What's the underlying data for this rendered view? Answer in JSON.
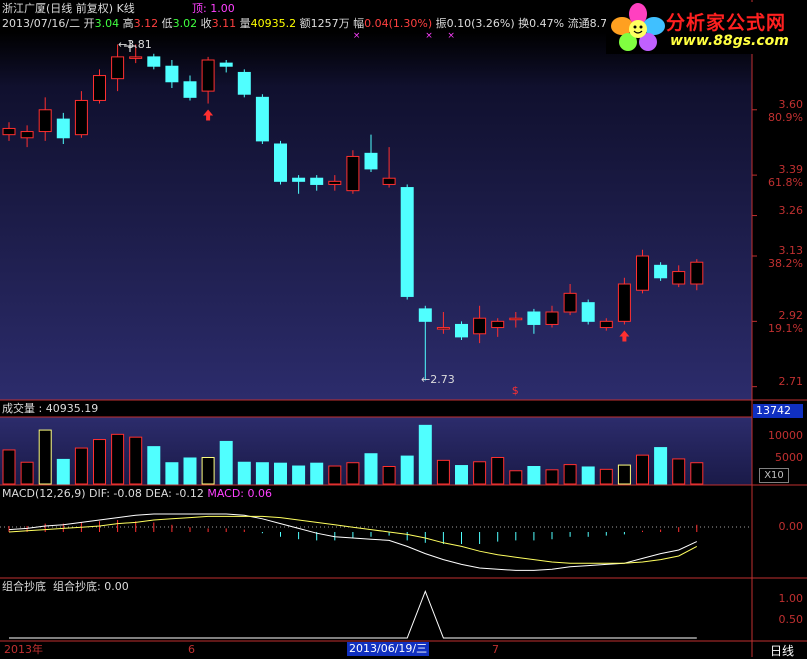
{
  "header": {
    "stock": "浙江广厦(日线 前复权) K线",
    "top_label": "顶: 1.00",
    "date": "2013/07/16/二",
    "open_label": "开",
    "open": "3.04",
    "high_label": "高",
    "high": "3.12",
    "low_label": "低",
    "low": "3.02",
    "close_label": "收",
    "close": "3.11",
    "vol_label": "量",
    "vol": "40935.2",
    "amount_label": "额",
    "amount": "1257万",
    "range_label": "幅",
    "range": "0.04(1.30%)",
    "amp_label": "振",
    "amp": "0.10(3.26%)",
    "turn_label": "换",
    "turn": "0.47%",
    "float_label": "流通",
    "float": "8.7"
  },
  "logo": {
    "title": "分析家公式网",
    "url": "www.88gs.com"
  },
  "colors": {
    "bg": "#000000",
    "panel": "#24245c",
    "up": "#ff3030",
    "down": "#50ffff",
    "grid": "#c03030"
  },
  "price_axis": [
    {
      "value": "3.60",
      "pct": "80.9%"
    },
    {
      "value": "3.39",
      "pct": "61.8%"
    },
    {
      "value": "3.26",
      "pct": ""
    },
    {
      "value": "3.13",
      "pct": "38.2%"
    },
    {
      "value": "2.92",
      "pct": "19.1%"
    },
    {
      "value": "2.71",
      "pct": ""
    }
  ],
  "price_annotations": {
    "high_mark": "3.81",
    "low_mark": "2.73"
  },
  "volume": {
    "title": "成交量",
    "value": ": 40935.19",
    "badge": "13742",
    "axis": [
      "10000",
      "5000"
    ],
    "unit": "X10"
  },
  "macd": {
    "title": "MACD(12,26,9)",
    "dif": "DIF: -0.08",
    "dea": "DEA: -0.12",
    "macd": "MACD: 0.06",
    "axis": "0.00"
  },
  "combo": {
    "title": "组合抄底",
    "value": "组合抄底: 0.00",
    "axis": [
      "1.00",
      "0.50"
    ]
  },
  "date_axis": {
    "labels": [
      "2013年",
      "6",
      "7"
    ],
    "highlight": "2013/06/19/三",
    "period": "日线"
  },
  "chart_data": {
    "type": "candlestick",
    "title": "浙江广厦(日线 前复权) K线",
    "ylim": [
      2.68,
      3.85
    ],
    "candles": [
      {
        "o": 3.52,
        "c": 3.54,
        "h": 3.56,
        "l": 3.5
      },
      {
        "o": 3.51,
        "c": 3.53,
        "h": 3.55,
        "l": 3.48
      },
      {
        "o": 3.53,
        "c": 3.6,
        "h": 3.64,
        "l": 3.5
      },
      {
        "o": 3.57,
        "c": 3.51,
        "h": 3.59,
        "l": 3.49
      },
      {
        "o": 3.52,
        "c": 3.63,
        "h": 3.66,
        "l": 3.51
      },
      {
        "o": 3.63,
        "c": 3.71,
        "h": 3.73,
        "l": 3.62
      },
      {
        "o": 3.7,
        "c": 3.77,
        "h": 3.81,
        "l": 3.66
      },
      {
        "o": 3.77,
        "c": 3.77,
        "h": 3.81,
        "l": 3.75
      },
      {
        "o": 3.77,
        "c": 3.74,
        "h": 3.78,
        "l": 3.73
      },
      {
        "o": 3.74,
        "c": 3.69,
        "h": 3.76,
        "l": 3.67
      },
      {
        "o": 3.69,
        "c": 3.64,
        "h": 3.71,
        "l": 3.63
      },
      {
        "o": 3.66,
        "c": 3.76,
        "h": 3.77,
        "l": 3.62
      },
      {
        "o": 3.75,
        "c": 3.74,
        "h": 3.76,
        "l": 3.72
      },
      {
        "o": 3.72,
        "c": 3.65,
        "h": 3.73,
        "l": 3.64
      },
      {
        "o": 3.64,
        "c": 3.5,
        "h": 3.65,
        "l": 3.49
      },
      {
        "o": 3.49,
        "c": 3.37,
        "h": 3.5,
        "l": 3.36
      },
      {
        "o": 3.38,
        "c": 3.37,
        "h": 3.39,
        "l": 3.33
      },
      {
        "o": 3.38,
        "c": 3.36,
        "h": 3.39,
        "l": 3.34
      },
      {
        "o": 3.36,
        "c": 3.37,
        "h": 3.39,
        "l": 3.34
      },
      {
        "o": 3.34,
        "c": 3.45,
        "h": 3.47,
        "l": 3.33
      },
      {
        "o": 3.46,
        "c": 3.41,
        "h": 3.52,
        "l": 3.4
      },
      {
        "o": 3.36,
        "c": 3.38,
        "h": 3.48,
        "l": 3.35
      },
      {
        "o": 3.35,
        "c": 3.0,
        "h": 3.36,
        "l": 2.99
      },
      {
        "o": 2.96,
        "c": 2.92,
        "h": 2.97,
        "l": 2.73
      },
      {
        "o": 2.9,
        "c": 2.9,
        "h": 2.95,
        "l": 2.88
      },
      {
        "o": 2.91,
        "c": 2.87,
        "h": 2.92,
        "l": 2.86
      },
      {
        "o": 2.88,
        "c": 2.93,
        "h": 2.97,
        "l": 2.85
      },
      {
        "o": 2.9,
        "c": 2.92,
        "h": 2.93,
        "l": 2.87
      },
      {
        "o": 2.93,
        "c": 2.93,
        "h": 2.95,
        "l": 2.9
      },
      {
        "o": 2.95,
        "c": 2.91,
        "h": 2.96,
        "l": 2.88
      },
      {
        "o": 2.91,
        "c": 2.95,
        "h": 2.97,
        "l": 2.9
      },
      {
        "o": 2.95,
        "c": 3.01,
        "h": 3.04,
        "l": 2.94
      },
      {
        "o": 2.98,
        "c": 2.92,
        "h": 2.99,
        "l": 2.91
      },
      {
        "o": 2.9,
        "c": 2.92,
        "h": 2.93,
        "l": 2.89
      },
      {
        "o": 2.92,
        "c": 3.04,
        "h": 3.06,
        "l": 2.91
      },
      {
        "o": 3.02,
        "c": 3.13,
        "h": 3.15,
        "l": 3.01
      },
      {
        "o": 3.1,
        "c": 3.06,
        "h": 3.11,
        "l": 3.05
      },
      {
        "o": 3.04,
        "c": 3.08,
        "h": 3.1,
        "l": 3.03
      },
      {
        "o": 3.04,
        "c": 3.11,
        "h": 3.12,
        "l": 3.02
      }
    ],
    "volume": [
      7200,
      4600,
      11400,
      5200,
      7600,
      9400,
      10500,
      9900,
      7900,
      4500,
      5500,
      5600,
      9000,
      4600,
      4500,
      4400,
      3800,
      4400,
      3800,
      4500,
      6400,
      3700,
      5900,
      12400,
      5000,
      3900,
      4700,
      5600,
      2800,
      3700,
      3000,
      4100,
      3600,
      3100,
      4000,
      6100,
      7700,
      5300,
      4500
    ],
    "volume_ylim": [
      0,
      13742
    ],
    "macd_hist": [
      0.05,
      0.05,
      0.07,
      0.07,
      0.08,
      0.09,
      0.1,
      0.09,
      0.08,
      0.06,
      0.04,
      0.03,
      0.03,
      0.02,
      -0.01,
      -0.04,
      -0.06,
      -0.07,
      -0.07,
      -0.05,
      -0.04,
      -0.03,
      -0.07,
      -0.09,
      -0.1,
      -0.1,
      -0.1,
      -0.08,
      -0.07,
      -0.07,
      -0.06,
      -0.04,
      -0.04,
      -0.03,
      -0.02,
      0.01,
      0.02,
      0.04,
      0.06
    ],
    "dif": [
      0.02,
      0.03,
      0.05,
      0.06,
      0.08,
      0.1,
      0.12,
      0.14,
      0.15,
      0.15,
      0.15,
      0.15,
      0.15,
      0.14,
      0.11,
      0.07,
      0.03,
      -0.01,
      -0.04,
      -0.05,
      -0.06,
      -0.07,
      -0.12,
      -0.18,
      -0.23,
      -0.27,
      -0.3,
      -0.31,
      -0.32,
      -0.32,
      -0.31,
      -0.29,
      -0.28,
      -0.27,
      -0.26,
      -0.22,
      -0.18,
      -0.15,
      -0.08
    ],
    "dea": [
      0.0,
      0.01,
      0.02,
      0.03,
      0.04,
      0.05,
      0.07,
      0.08,
      0.1,
      0.11,
      0.12,
      0.13,
      0.13,
      0.13,
      0.13,
      0.12,
      0.1,
      0.08,
      0.06,
      0.04,
      0.02,
      0.0,
      -0.02,
      -0.05,
      -0.09,
      -0.12,
      -0.16,
      -0.19,
      -0.21,
      -0.23,
      -0.25,
      -0.26,
      -0.26,
      -0.26,
      -0.26,
      -0.25,
      -0.23,
      -0.2,
      -0.12
    ],
    "macd_ylim": [
      -0.35,
      0.35
    ],
    "combo": [
      0,
      0,
      0,
      0,
      0,
      0,
      0,
      0,
      0,
      0,
      0,
      0,
      0,
      0,
      0,
      0,
      0,
      0,
      0,
      0,
      0,
      0,
      0,
      1,
      0,
      0,
      0,
      0,
      0,
      0,
      0,
      0,
      0,
      0,
      0,
      0,
      0,
      0,
      0
    ],
    "combo_ylim": [
      0,
      1.2
    ]
  }
}
